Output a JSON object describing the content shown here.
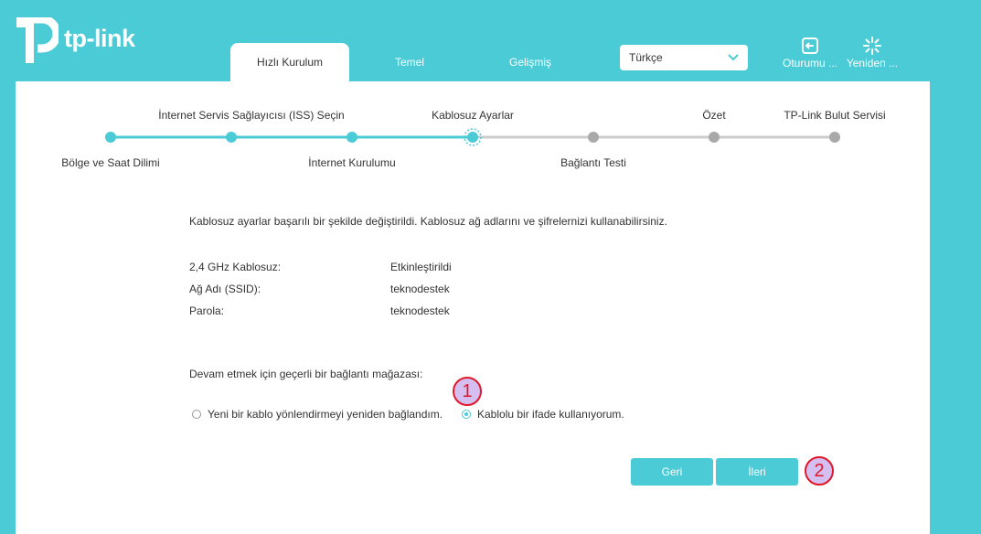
{
  "brand": {
    "name": "tp-link"
  },
  "tabs": [
    {
      "label": "Hızlı Kurulum",
      "active": true
    },
    {
      "label": "Temel",
      "active": false
    },
    {
      "label": "Gelişmiş",
      "active": false
    }
  ],
  "language": {
    "selected": "Türkçe"
  },
  "header_buttons": {
    "logout": "Oturumu ...",
    "reboot": "Yeniden ..."
  },
  "steps": [
    {
      "label": "Bölge ve Saat Dilimi",
      "state": "done"
    },
    {
      "label": "İnternet Servis Sağlayıcısı (ISS) Seçin",
      "state": "done"
    },
    {
      "label": "İnternet Kurulumu",
      "state": "done"
    },
    {
      "label": "Kablosuz Ayarlar",
      "state": "current"
    },
    {
      "label": "Bağlantı Testi",
      "state": "todo"
    },
    {
      "label": "Özet",
      "state": "todo"
    },
    {
      "label": "TP-Link Bulut Servisi",
      "state": "todo"
    }
  ],
  "intro": "Kablosuz ayarlar başarılı bir şekilde değiştirildi. Kablosuz ağ adlarını ve şifrelernizi kullanabilirsiniz.",
  "info_rows": [
    {
      "label": "2,4 GHz Kablosuz:",
      "value": "Etkinleştirildi"
    },
    {
      "label": "Ağ Adı (SSID):",
      "value": "teknodestek"
    },
    {
      "label": "Parola:",
      "value": "teknodestek"
    }
  ],
  "prompt": "Devam etmek için geçerli bir bağlantı mağazası:",
  "options": [
    {
      "label": "Yeni bir kablo yönlendirmeyi yeniden bağlandım.",
      "checked": false
    },
    {
      "label": "Kablolu bir ifade kullanıyorum.",
      "checked": true
    }
  ],
  "buttons": {
    "back": "Geri",
    "next": "İleri"
  },
  "callouts": [
    "1",
    "2"
  ],
  "colors": {
    "accent": "#4acbd6",
    "inactive": "#a9a9a9",
    "callout_border": "#e0182a",
    "callout_fill": "#d4bff0"
  }
}
